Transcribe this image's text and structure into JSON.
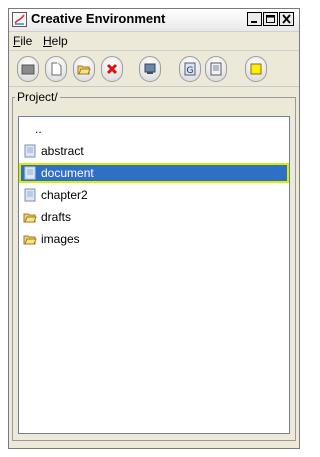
{
  "window": {
    "title": "Creative Environment",
    "controls": [
      "minimize",
      "maximize",
      "close"
    ]
  },
  "menu": {
    "file_label": "File",
    "file_mnemonic": "F",
    "file_rest": "ile",
    "help_label": "Help",
    "help_mnemonic": "H",
    "help_rest": "elp"
  },
  "toolbar": {
    "buttons": [
      {
        "icon": "folder-closed-icon"
      },
      {
        "icon": "new-document-icon"
      },
      {
        "icon": "open-folder-icon"
      },
      {
        "icon": "delete-icon"
      },
      {
        "icon": "monitor-icon"
      },
      {
        "icon": "g-icon"
      },
      {
        "icon": "document-icon"
      },
      {
        "icon": "note-icon"
      }
    ]
  },
  "panel": {
    "legend": "Project/"
  },
  "files": [
    {
      "label": "..",
      "type": "parent"
    },
    {
      "label": "abstract",
      "type": "file"
    },
    {
      "label": "document",
      "type": "file",
      "selected": true
    },
    {
      "label": "chapter2",
      "type": "file"
    },
    {
      "label": "drafts",
      "type": "folder"
    },
    {
      "label": "images",
      "type": "folder"
    }
  ],
  "colors": {
    "selection": "#2f6fc5",
    "selection_border": "#d8f000",
    "window_bg": "#ece9d8"
  }
}
